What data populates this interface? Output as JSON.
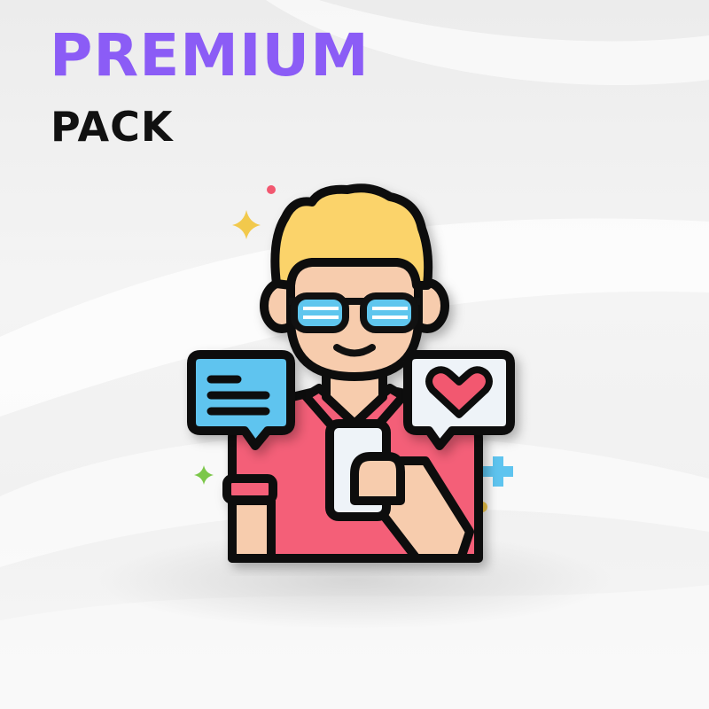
{
  "header": {
    "title": "PREMIUM",
    "subtitle": "PACK"
  },
  "colors": {
    "title": "#8b5cf6",
    "subtitle": "#111111",
    "shirt": "#f45f78",
    "skin": "#f7ccad",
    "hair": "#fbd36b",
    "glasses": "#5fc6ee",
    "chat_bubble": "#5ec4ef",
    "heart": "#f25870",
    "outline": "#111111"
  },
  "illustration": {
    "subject": "person-using-phone",
    "icons": [
      "chat-bubble-icon",
      "heart-bubble-icon",
      "phone-icon",
      "sparkle-icon"
    ]
  }
}
